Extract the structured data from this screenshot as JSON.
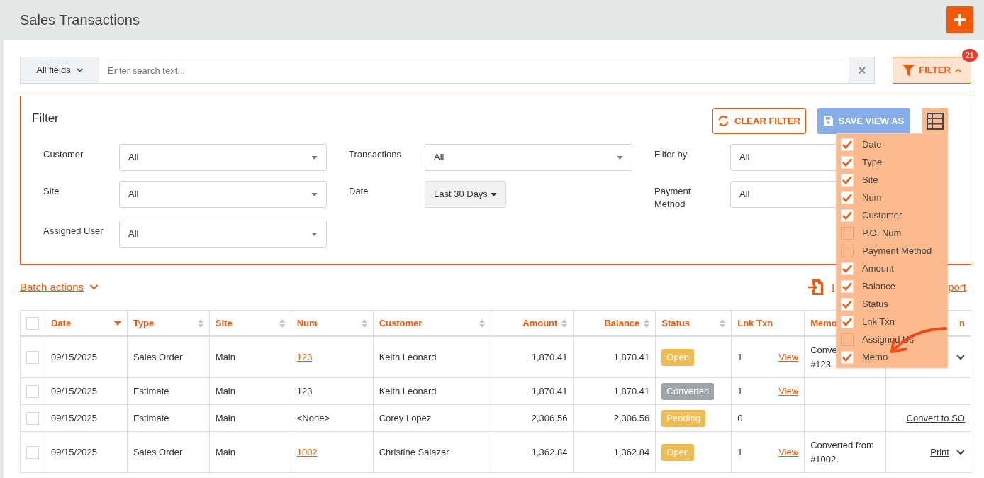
{
  "page": {
    "title": "Sales Transactions"
  },
  "search": {
    "scope": "All fields",
    "placeholder": "Enter search text..."
  },
  "filter_button": {
    "label": "FILTER",
    "badge": "21",
    "expanded": true
  },
  "filter_panel": {
    "title": "Filter",
    "clear_button": "CLEAR FILTER",
    "save_button": "SAVE VIEW AS",
    "fields": [
      {
        "label": "Customer",
        "value": "All",
        "kind": "select"
      },
      {
        "label": "Transactions",
        "value": "All",
        "kind": "select"
      },
      {
        "label": "Filter by",
        "value": "All",
        "kind": "select"
      },
      {
        "label": "Site",
        "value": "All",
        "kind": "select"
      },
      {
        "label": "Date",
        "value": "Last 30 Days",
        "kind": "button"
      },
      {
        "label": "Payment Method",
        "value": "All",
        "kind": "select"
      },
      {
        "label": "Assigned User",
        "value": "All",
        "kind": "select"
      }
    ]
  },
  "column_menu": {
    "items": [
      {
        "label": "Date",
        "checked": true
      },
      {
        "label": "Type",
        "checked": true
      },
      {
        "label": "Site",
        "checked": true
      },
      {
        "label": "Num",
        "checked": true
      },
      {
        "label": "Customer",
        "checked": true
      },
      {
        "label": "P.O. Num",
        "checked": false
      },
      {
        "label": "Payment Method",
        "checked": false
      },
      {
        "label": "Amount",
        "checked": true
      },
      {
        "label": "Balance",
        "checked": true
      },
      {
        "label": "Status",
        "checked": true
      },
      {
        "label": "Lnk Txn",
        "checked": true
      },
      {
        "label": "Assigned Us",
        "checked": false
      },
      {
        "label": "Memo",
        "checked": true
      }
    ]
  },
  "batch_actions": "Batch actions",
  "import_link": "I",
  "export_link": "port",
  "table": {
    "all_selected": false,
    "columns": [
      {
        "label": "Date",
        "sortable": true,
        "sorted": true
      },
      {
        "label": "Type",
        "sortable": true,
        "sorted": false
      },
      {
        "label": "Site",
        "sortable": true,
        "sorted": false
      },
      {
        "label": "Num",
        "sortable": true,
        "sorted": false
      },
      {
        "label": "Customer",
        "sortable": true,
        "sorted": false
      },
      {
        "label": "Amount",
        "sortable": true,
        "sorted": false
      },
      {
        "label": "Balance",
        "sortable": true,
        "sorted": false
      },
      {
        "label": "Status",
        "sortable": true,
        "sorted": false
      },
      {
        "label": "Lnk Txn",
        "sortable": false
      },
      {
        "label": "Memo",
        "sortable": false
      },
      {
        "label": "n",
        "sortable": false
      }
    ],
    "rows": [
      {
        "selected": false,
        "date": "09/15/2025",
        "type": "Sales Order",
        "site": "Main",
        "num": {
          "text": "123",
          "link": true
        },
        "customer": "Keith Leonard",
        "amount": "1,870.41",
        "balance": "1,870.41",
        "status": {
          "label": "Open",
          "color": "#f0bb4f"
        },
        "lnk": {
          "count": "1",
          "link": "View"
        },
        "memo": [
          "Conve",
          "#123."
        ],
        "action": {
          "menu": true
        }
      },
      {
        "selected": false,
        "date": "09/15/2025",
        "type": "Estimate",
        "site": "Main",
        "num": {
          "text": "123",
          "link": false
        },
        "customer": "Keith Leonard",
        "amount": "1,870.41",
        "balance": "1,870.41",
        "status": {
          "label": "Converted",
          "color": "#9fa4a9"
        },
        "lnk": {
          "count": "1",
          "link": "View"
        },
        "action": {
          "menu": false
        }
      },
      {
        "selected": false,
        "date": "09/15/2025",
        "type": "Estimate",
        "site": "Main",
        "num": {
          "text": "<None>",
          "link": false
        },
        "customer": "Corey Lopez",
        "amount": "2,306.56",
        "balance": "2,306.56",
        "status": {
          "label": "Pending",
          "color": "#f0bb4f"
        },
        "lnk": {
          "count": "0"
        },
        "action": {
          "label": "Convert to SO",
          "menu": false
        }
      },
      {
        "selected": false,
        "date": "09/15/2025",
        "type": "Sales Order",
        "site": "Main",
        "num": {
          "text": "1002",
          "link": true
        },
        "customer": "Christine Salazar",
        "amount": "1,362.84",
        "balance": "1,362.84",
        "status": {
          "label": "Open",
          "color": "#f0bb4f"
        },
        "lnk": {
          "count": "1",
          "link": "View"
        },
        "memo": [
          "Converted from",
          "#1002."
        ],
        "action": {
          "label": "Print",
          "menu": true
        }
      }
    ]
  }
}
